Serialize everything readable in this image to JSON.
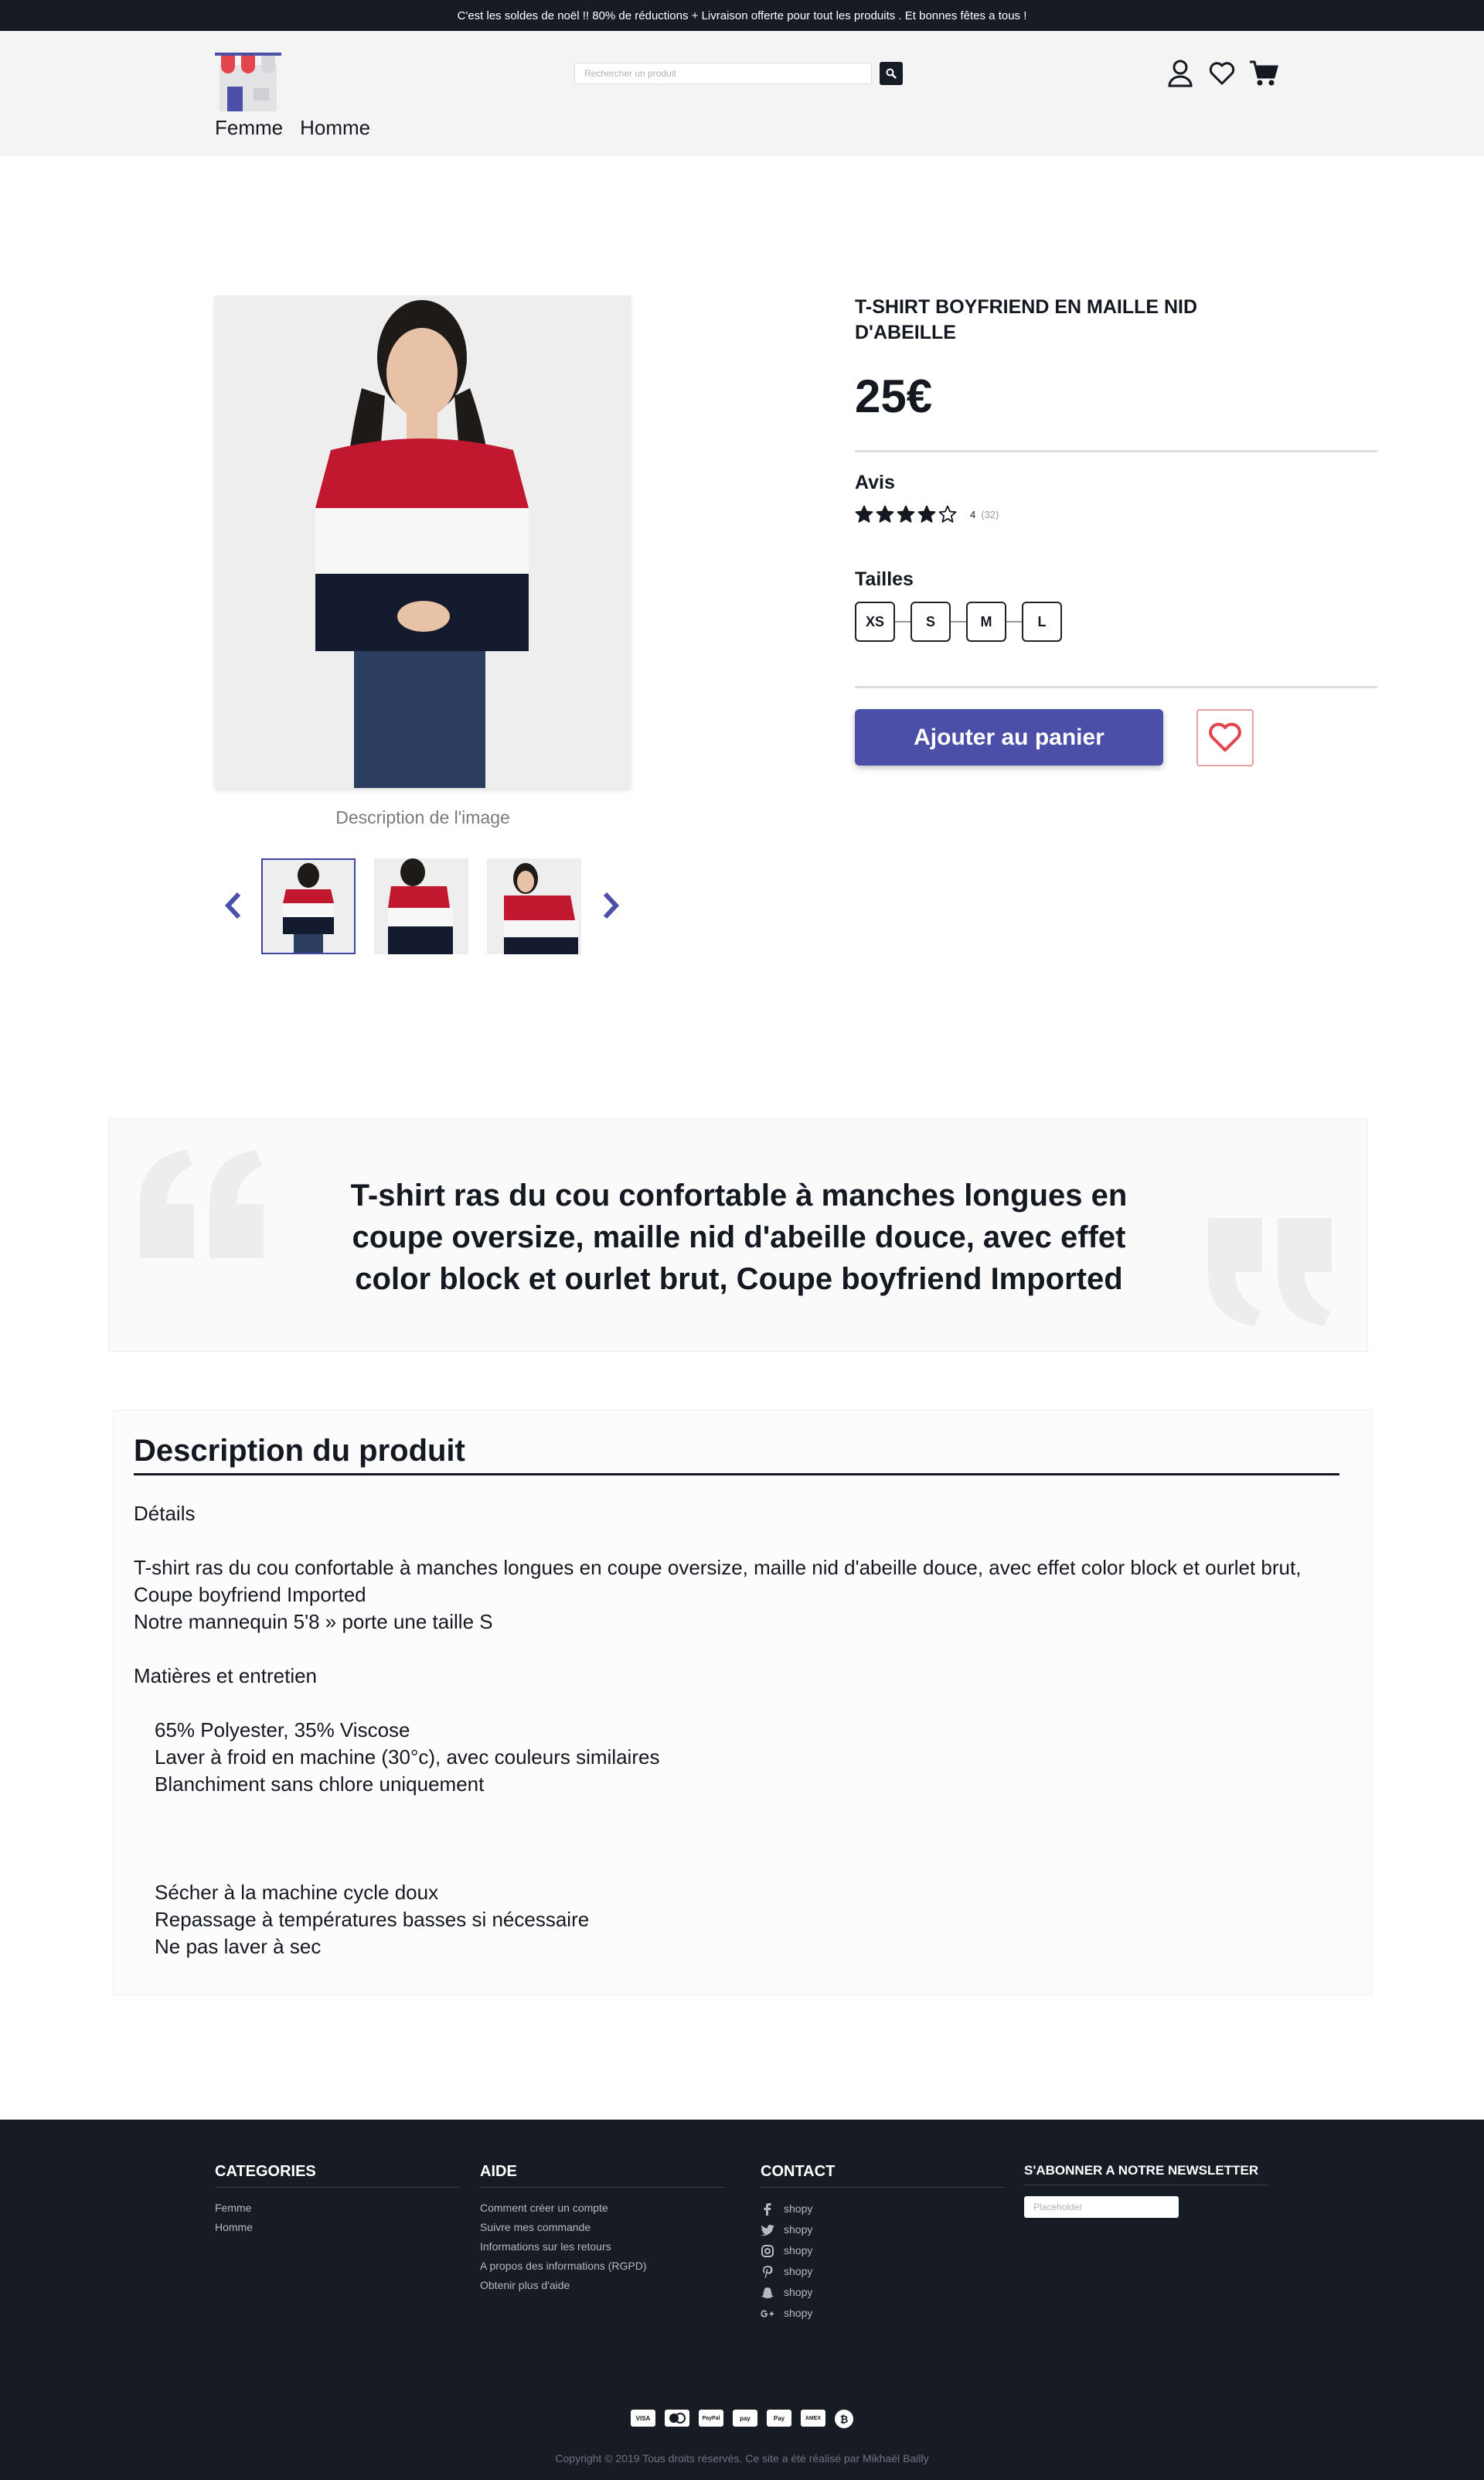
{
  "announcement": "C'est les soldes de noël !! 80% de réductions + Livraison offerte pour tout les produits . Et bonnes fêtes a tous !",
  "header": {
    "nav": [
      "Femme",
      "Homme"
    ],
    "search_placeholder": "Rechercher un produit",
    "icons": [
      "user-icon",
      "heart-icon",
      "cart-icon"
    ]
  },
  "product": {
    "title": "T-SHIRT BOYFRIEND EN MAILLE NID D'ABEILLE",
    "price": "25€",
    "reviews_label": "Avis",
    "rating": "4",
    "rating_count": "(32)",
    "rating_value": 4,
    "rating_max": 5,
    "sizes_label": "Tailles",
    "sizes": [
      "XS",
      "S",
      "M",
      "L"
    ],
    "add_to_cart": "Ajouter au panier",
    "image_caption": "Description de l'image"
  },
  "quote": "T-shirt ras du cou confortable à manches longues en coupe oversize, maille nid d'abeille douce, avec effet color block et ourlet brut, Coupe boyfriend Imported",
  "description": {
    "title": "Description du produit",
    "details_label": "Détails",
    "details_text": "T-shirt ras du cou confortable à manches longues en coupe oversize, maille nid d'abeille douce, avec effet color block et ourlet brut, Coupe boyfriend Imported",
    "model_note": "Notre mannequin 5'8 » porte une taille S",
    "care_label": "Matières et entretien",
    "care_items_1": [
      "65% Polyester, 35% Viscose",
      "Laver à froid en machine (30°c), avec couleurs similaires",
      "Blanchiment sans chlore uniquement"
    ],
    "care_items_2": [
      "Sécher à la machine cycle doux",
      "Repassage à températures basses si nécessaire",
      "Ne pas laver à sec"
    ]
  },
  "footer": {
    "categories": {
      "title": "CATEGORIES",
      "items": [
        "Femme",
        "Homme"
      ]
    },
    "aide": {
      "title": "AIDE",
      "items": [
        "Comment créer un compte",
        "Suivre mes commande",
        "Informations sur les retours",
        "A propos des informations (RGPD)",
        "Obtenir plus d'aide"
      ]
    },
    "contact": {
      "title": "CONTACT",
      "items": [
        "shopy",
        "shopy",
        "shopy",
        "shopy",
        "shopy",
        "shopy"
      ]
    },
    "newsletter": {
      "title": "S'ABONNER A NOTRE NEWSLETTER",
      "placeholder": "Placeholder"
    },
    "payments": {
      "visa": "VISA",
      "paypal": "PayPal",
      "amazon": "pay",
      "apple": "Pay",
      "amex": "AMEX",
      "bitcoin": "₿"
    },
    "copyright": "Copyright © 2019 Tous droits réservés. Ce site a été réalisé par Mikhaël Bailly"
  },
  "colors": {
    "accent": "#4b4fa8",
    "dark": "#171b24",
    "wishlist": "#e2454c",
    "shirt_red": "#c2182f"
  }
}
